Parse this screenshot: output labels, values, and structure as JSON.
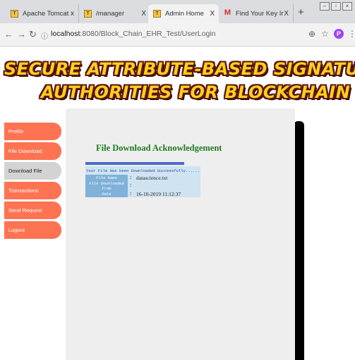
{
  "browser": {
    "tabs": [
      {
        "title": "Apache Tomcat",
        "close": "x",
        "icon": "tomcat-icon",
        "active": false
      },
      {
        "title": "/manager",
        "close": "X",
        "icon": "tomcat-icon",
        "active": false
      },
      {
        "title": "Admin Home",
        "close": "X",
        "icon": "tomcat-icon",
        "active": true
      },
      {
        "title": "Find Your Key Info - priya(",
        "close": "X",
        "icon": "gmail-icon",
        "active": false
      }
    ],
    "new_tab": "+",
    "url_host": "localhost",
    "url_path": ":8080/Block_Chain_EHR_Test/UserLogin",
    "profile_initial": "P"
  },
  "header": {
    "title_line1": "SECURE ATTRIBUTE-BASED SIGNATURE SCHEME WITH MULTIPLE",
    "title_line2": "AUTHORITIES FOR BLOCKCHAIN IN EHR SYSTEMS",
    "title_color": "#ffcf1f",
    "outline_color": "#5a1608"
  },
  "sidebar": {
    "items": [
      {
        "label": "Profile",
        "active": false
      },
      {
        "label": "File Download",
        "active": false
      },
      {
        "label": "Download File",
        "active": true
      },
      {
        "label": "Transactions",
        "active": false
      },
      {
        "label": "Send Request",
        "active": false
      },
      {
        "label": "Logout",
        "active": false
      }
    ],
    "accent_color": "#fe7352"
  },
  "main": {
    "heading": "File Download Acknowledgement",
    "message": "Your File Has been Downloaded Successfully......",
    "rows": [
      {
        "label": "File Name",
        "colon": ":",
        "value": "datascience.txt"
      },
      {
        "label": "File Downloaded From",
        "colon": ":",
        "value": ""
      },
      {
        "label": "Date",
        "colon": ":",
        "value": "16-10-2019  11:12:37"
      }
    ]
  }
}
